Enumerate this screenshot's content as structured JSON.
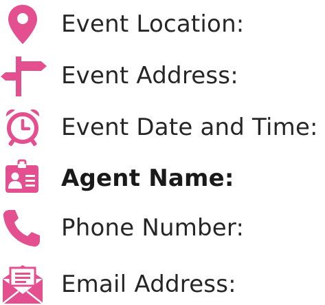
{
  "accent_color": "#e4508f",
  "items": [
    {
      "icon": "location-pin-icon",
      "label": "Event Location:",
      "bold": false
    },
    {
      "icon": "signpost-icon",
      "label": "Event Address:",
      "bold": false
    },
    {
      "icon": "alarm-clock-icon",
      "label": "Event Date and Time:",
      "bold": false
    },
    {
      "icon": "id-badge-icon",
      "label": "Agent Name:",
      "bold": true
    },
    {
      "icon": "phone-icon",
      "label": "Phone Number:",
      "bold": false
    },
    {
      "icon": "envelope-letter-icon",
      "label": "Email Address:",
      "bold": false
    }
  ]
}
